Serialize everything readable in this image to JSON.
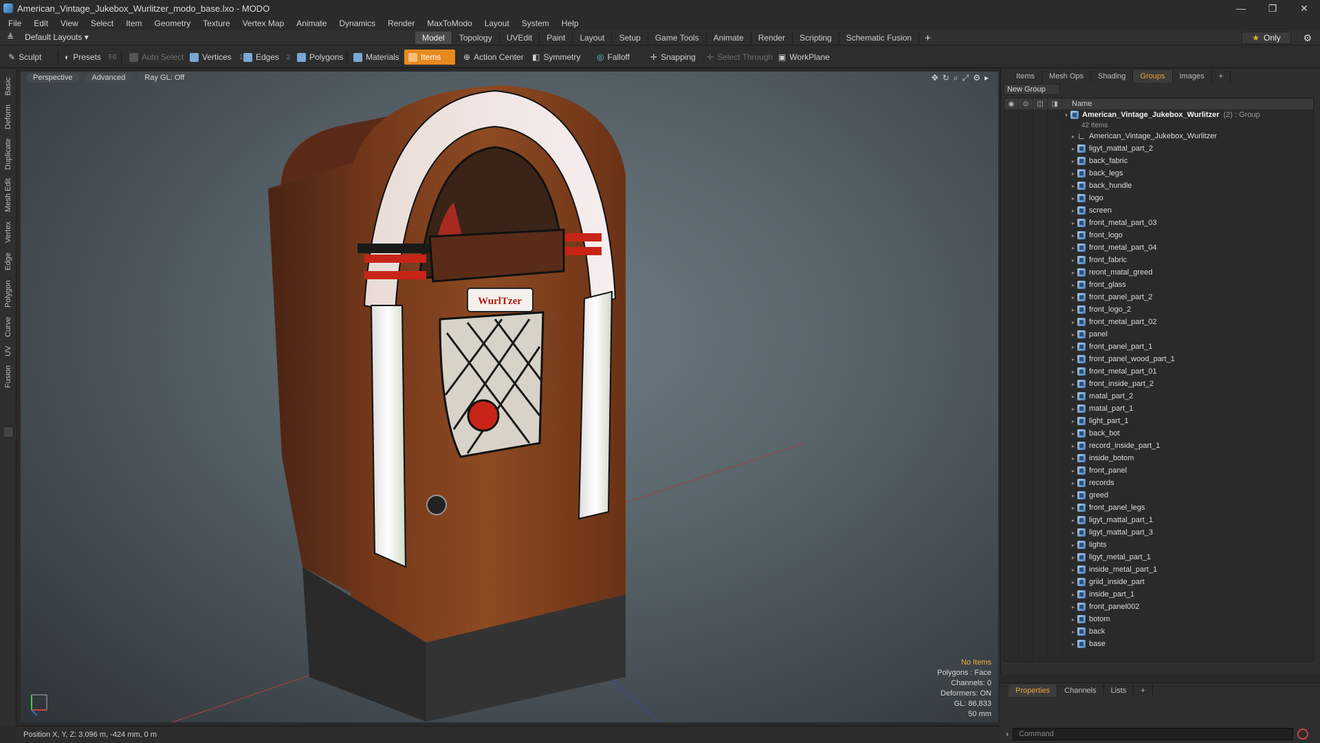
{
  "window": {
    "title": "American_Vintage_Jukebox_Wurlitzer_modo_base.lxo - MODO",
    "controls": [
      "—",
      "❐",
      "✕"
    ]
  },
  "menu": [
    "File",
    "Edit",
    "View",
    "Select",
    "Item",
    "Geometry",
    "Texture",
    "Vertex Map",
    "Animate",
    "Dynamics",
    "Render",
    "MaxToModo",
    "Layout",
    "System",
    "Help"
  ],
  "layout": {
    "dropdown": "Default Layouts",
    "tabs": [
      "Model",
      "Topology",
      "UVEdit",
      "Paint",
      "Layout",
      "Setup",
      "Game Tools",
      "Animate",
      "Render",
      "Scripting",
      "Schematic Fusion"
    ],
    "active_tab": "Model",
    "only_label": "Only"
  },
  "toolbar": {
    "sculpt": "Sculpt",
    "presets": "Presets",
    "presets_key": "F6",
    "auto_select": "Auto Select",
    "vertices": "Vertices",
    "vertices_key": "1",
    "edges": "Edges",
    "edges_key": "2",
    "polygons": "Polygons",
    "materials": "Materials",
    "items": "Items",
    "action_center": "Action Center",
    "symmetry": "Symmetry",
    "falloff": "Falloff",
    "snapping": "Snapping",
    "select_through": "Select Through",
    "workplane": "WorkPlane"
  },
  "left_tabs": [
    "Basic",
    "Deform",
    "Duplicate",
    "Mesh Edit",
    "Vertex",
    "Edge",
    "Polygon",
    "Curve",
    "UV",
    "Fusion"
  ],
  "viewport": {
    "view": "Perspective",
    "shading": "Advanced",
    "raygl": "Ray GL: Off",
    "logo_text": "WurlTzer",
    "info": {
      "no_items": "No Items",
      "polygons": "Polygons : Face",
      "channels": "Channels: 0",
      "deformers": "Deformers: ON",
      "gl": "GL: 86,833",
      "focal": "50 mm"
    }
  },
  "status": {
    "position": "Position X, Y, Z:  3.096 m, -424 mm, 0 m"
  },
  "right_panel": {
    "tabs": [
      "Items",
      "Mesh Ops",
      "Shading",
      "Groups",
      "Images"
    ],
    "active_tab": "Groups",
    "new_group": "New Group",
    "column_name": "Name",
    "group": {
      "name": "American_Vintage_Jukebox_Wurlitzer",
      "meta": "(2) : Group",
      "count": "42 Items"
    },
    "items": [
      "American_Vintage_Jukebox_Wurlitzer",
      "ligyt_mattal_part_2",
      "back_fabric",
      "back_legs",
      "back_hundle",
      "logo",
      "screen",
      "front_metal_part_03",
      "front_logo",
      "front_metal_part_04",
      "front_fabric",
      "reont_matal_greed",
      "front_glass",
      "front_panel_part_2",
      "front_logo_2",
      "front_metal_part_02",
      "panel",
      "front_panel_part_1",
      "front_panel_wood_part_1",
      "front_metal_part_01",
      "front_inside_part_2",
      "matal_part_2",
      "matal_part_1",
      "light_part_1",
      "back_bot",
      "record_inside_part_1",
      "inside_botom",
      "front_panel",
      "records",
      "greed",
      "front_panel_legs",
      "ligyt_mattal_part_1",
      "ligyt_mattal_part_3",
      "lights",
      "ligyt_metal_part_1",
      "inside_metal_part_1",
      "griid_inside_part",
      "inside_part_1",
      "front_panel002",
      "botom",
      "back",
      "base"
    ]
  },
  "bottom_panel": {
    "tabs": [
      "Properties",
      "Channels",
      "Lists"
    ],
    "active_tab": "Properties",
    "command_placeholder": "Command"
  },
  "colors": {
    "accent": "#e8891e",
    "panel": "#2e2e2e",
    "viewport": "#5b666d"
  }
}
